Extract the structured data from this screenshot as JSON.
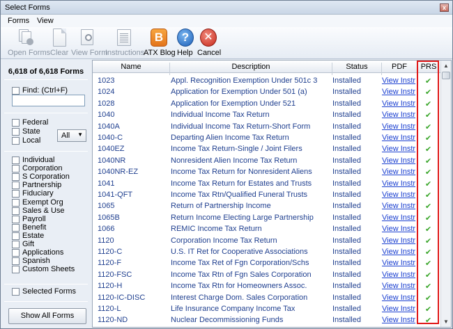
{
  "window": {
    "title": "Select Forms",
    "close_glyph": "x"
  },
  "menu": [
    "Forms",
    "View"
  ],
  "toolbar": {
    "open_forms": "Open Forms",
    "clear": "Clear",
    "view_form": "View Form",
    "instructions": "Instructions",
    "atx_blog": "ATX Blog",
    "help": "Help",
    "cancel": "Cancel",
    "blog_glyph": "B",
    "help_glyph": "?",
    "cancel_glyph": "✕"
  },
  "left": {
    "count": "6,618 of 6,618 Forms",
    "find_label": "Find: (Ctrl+F)",
    "find_value": "",
    "jurisdiction": [
      "Federal",
      "State",
      "Local"
    ],
    "state_select": "All",
    "entity_types": [
      "Individual",
      "Corporation",
      "S Corporation",
      "Partnership",
      "Fiduciary",
      "Exempt Org",
      "Sales & Use",
      "Payroll",
      "Benefit",
      "Estate",
      "Gift",
      "Applications",
      "Spanish",
      "Custom Sheets"
    ],
    "selected_forms": "Selected Forms",
    "show_all": "Show All Forms"
  },
  "grid": {
    "headers": {
      "name": "Name",
      "description": "Description",
      "status": "Status",
      "pdf": "PDF",
      "prs": "PRS"
    },
    "check_glyph": "✔",
    "rows": [
      {
        "name": "1023",
        "description": "Appl. Recognition Exemption Under 501c 3",
        "status": "Installed",
        "pdf": "View Instr"
      },
      {
        "name": "1024",
        "description": "Application for Exemption Under 501 (a)",
        "status": "Installed",
        "pdf": "View Instr"
      },
      {
        "name": "1028",
        "description": "Application for Exemption Under 521",
        "status": "Installed",
        "pdf": "View Instr"
      },
      {
        "name": "1040",
        "description": "Individual Income Tax Return",
        "status": "Installed",
        "pdf": "View Instr"
      },
      {
        "name": "1040A",
        "description": "Individual Income Tax Return-Short Form",
        "status": "Installed",
        "pdf": "View Instr"
      },
      {
        "name": "1040-C",
        "description": "Departing Alien Income Tax Return",
        "status": "Installed",
        "pdf": "View Instr"
      },
      {
        "name": "1040EZ",
        "description": "Income Tax Return-Single / Joint Filers",
        "status": "Installed",
        "pdf": "View Instr"
      },
      {
        "name": "1040NR",
        "description": "Nonresident Alien Income Tax Return",
        "status": "Installed",
        "pdf": "View Instr"
      },
      {
        "name": "1040NR-EZ",
        "description": "Income Tax Return for Nonresident Aliens",
        "status": "Installed",
        "pdf": "View Instr"
      },
      {
        "name": "1041",
        "description": "Income Tax Return for Estates and Trusts",
        "status": "Installed",
        "pdf": "View Instr"
      },
      {
        "name": "1041-QFT",
        "description": "Income Tax Rtn/Qualified Funeral Trusts",
        "status": "Installed",
        "pdf": "View Instr"
      },
      {
        "name": "1065",
        "description": "Return of Partnership Income",
        "status": "Installed",
        "pdf": "View Instr"
      },
      {
        "name": "1065B",
        "description": "Return Income Electing Large Partnership",
        "status": "Installed",
        "pdf": "View Instr"
      },
      {
        "name": "1066",
        "description": "REMIC Income Tax Return",
        "status": "Installed",
        "pdf": "View Instr"
      },
      {
        "name": "1120",
        "description": "Corporation Income Tax Return",
        "status": "Installed",
        "pdf": "View Instr"
      },
      {
        "name": "1120-C",
        "description": "U.S. IT Ret for Cooperative Associations",
        "status": "Installed",
        "pdf": "View Instr"
      },
      {
        "name": "1120-F",
        "description": "Income Tax Ret of Fgn Corporation/Schs",
        "status": "Installed",
        "pdf": "View Instr"
      },
      {
        "name": "1120-FSC",
        "description": "Income Tax Rtn of Fgn Sales Corporation",
        "status": "Installed",
        "pdf": "View Instr"
      },
      {
        "name": "1120-H",
        "description": "Income Tax Rtn for Homeowners Assoc.",
        "status": "Installed",
        "pdf": "View Instr"
      },
      {
        "name": "1120-IC-DISC",
        "description": "Interest Charge Dom. Sales Corporation",
        "status": "Installed",
        "pdf": "View Instr"
      },
      {
        "name": "1120-L",
        "description": "Life Insurance Company Income Tax",
        "status": "Installed",
        "pdf": "View Instr"
      },
      {
        "name": "1120-ND",
        "description": "Nuclear Decommissioning Funds",
        "status": "Installed",
        "pdf": "View Instr"
      }
    ]
  },
  "scrollbar": {
    "up_glyph": "▲",
    "down_glyph": "▼"
  }
}
